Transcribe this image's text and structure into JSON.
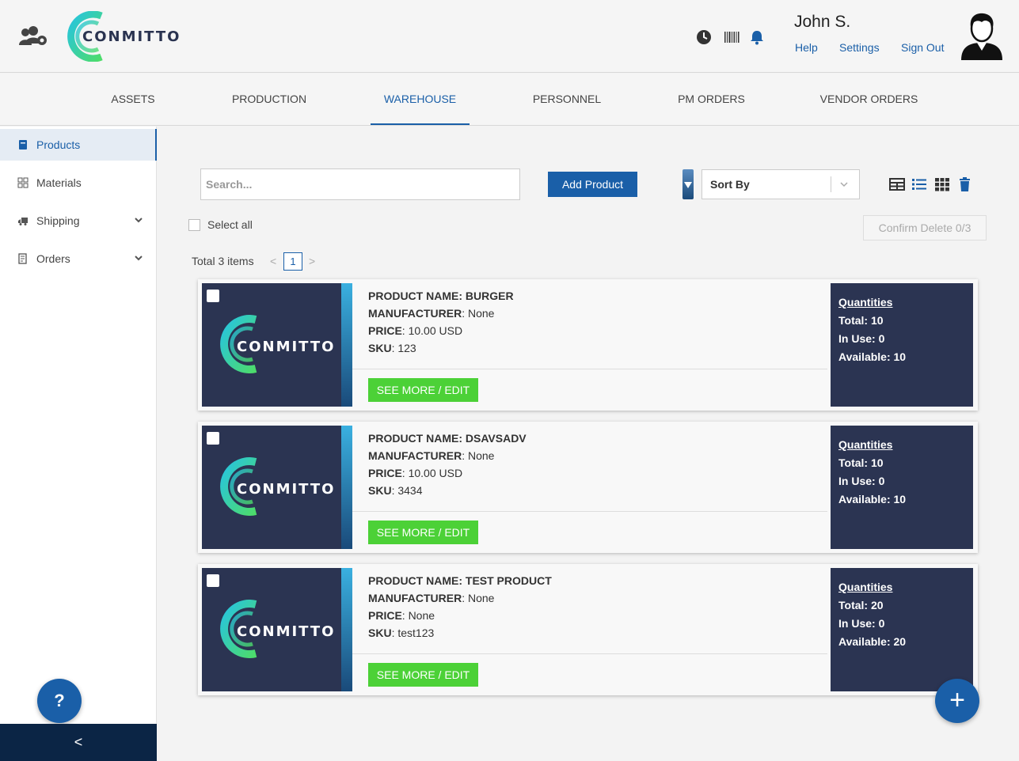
{
  "header": {
    "logo_text": "CONMITTO",
    "user_name": "John S.",
    "links": [
      "Help",
      "Settings",
      "Sign Out"
    ]
  },
  "nav": {
    "tabs": [
      "ASSETS",
      "PRODUCTION",
      "WAREHOUSE",
      "PERSONNEL",
      "PM ORDERS",
      "VENDOR ORDERS"
    ],
    "active": "WAREHOUSE"
  },
  "sidebar": {
    "items": [
      "Products",
      "Materials",
      "Shipping",
      "Orders"
    ],
    "active": "Products",
    "help_label": "?",
    "collapse_label": "<"
  },
  "toolbar": {
    "search_placeholder": "Search...",
    "add_label": "Add Product",
    "sort_label": "Sort By",
    "select_all_label": "Select all",
    "confirm_delete_label": "Confirm Delete 0/3"
  },
  "pagination": {
    "total_label": "Total 3 items",
    "prev": "<",
    "current_page": "1",
    "next": ">"
  },
  "labels": {
    "product_name": "PRODUCT NAME:",
    "manufacturer": "MANUFACTURER",
    "price": "PRICE",
    "sku": "SKU",
    "see_more": "SEE MORE / EDIT",
    "quantities": "Quantities",
    "total": "Total:",
    "in_use": "In Use:",
    "available": "Available:"
  },
  "products": [
    {
      "name": "BURGER",
      "manufacturer": ": None",
      "price": ": 10.00 USD",
      "sku": ": 123",
      "total": "10",
      "in_use": "0",
      "available": "10"
    },
    {
      "name": "DSAVSADV",
      "manufacturer": ": None",
      "price": ": 10.00 USD",
      "sku": ": 3434",
      "total": "10",
      "in_use": "0",
      "available": "10"
    },
    {
      "name": "TEST PRODUCT",
      "manufacturer": ": None",
      "price": ": None",
      "sku": ": test123",
      "total": "20",
      "in_use": "0",
      "available": "20"
    }
  ],
  "fab_label": "+",
  "colors": {
    "primary": "#1a5fa8",
    "green": "#4cd137",
    "navy": "#2b3452",
    "dark": "#0b2545"
  }
}
